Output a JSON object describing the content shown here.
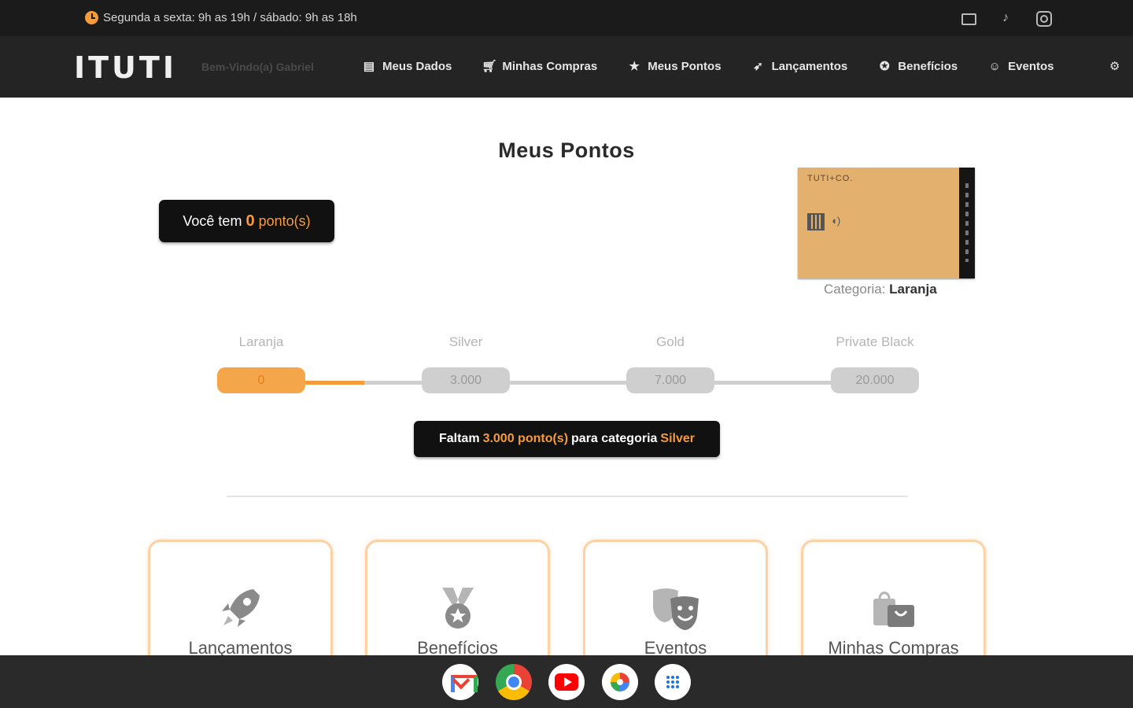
{
  "topbar": {
    "hours": "Segunda a sexta: 9h as 19h / sábado: 9h as 18h",
    "social_icons": [
      "mail-icon",
      "tiktok-icon",
      "instagram-icon"
    ]
  },
  "navbar": {
    "logo": "ITUTI",
    "welcome": "Bem-Vindo(a) Gabriel",
    "items": [
      {
        "label": "Meus Dados",
        "icon": "id-card-icon"
      },
      {
        "label": "Minhas Compras",
        "icon": "cart-icon"
      },
      {
        "label": "Meus Pontos",
        "icon": "star-icon"
      },
      {
        "label": "Lançamentos",
        "icon": "rocket-icon"
      },
      {
        "label": "Benefícios",
        "icon": "medal-icon"
      },
      {
        "label": "Eventos",
        "icon": "masks-icon"
      }
    ]
  },
  "main": {
    "title": "Meus Pontos",
    "points_box": {
      "prefix": "Você tem",
      "points": "0",
      "unit": "ponto(s)"
    },
    "card": {
      "brand": "TUTI+CO.",
      "category_label": "Categoria:",
      "category_value": "Laranja"
    },
    "levels": [
      {
        "name": "Laranja",
        "threshold": "0"
      },
      {
        "name": "Silver",
        "threshold": "3.000"
      },
      {
        "name": "Gold",
        "threshold": "7.000"
      },
      {
        "name": "Private Black",
        "threshold": "20.000"
      }
    ],
    "progress_fraction": 0.17,
    "remaining": {
      "prefix": "Faltam",
      "points": "3.000 ponto(s)",
      "middle": "para categoria",
      "next": "Silver"
    },
    "tiles": [
      {
        "label": "Lançamentos",
        "icon": "rocket-icon"
      },
      {
        "label": "Benefícios",
        "icon": "medal-icon"
      },
      {
        "label": "Eventos",
        "icon": "masks-icon"
      },
      {
        "label": "Minhas Compras",
        "icon": "shopping-bag-icon"
      }
    ]
  },
  "shelf": {
    "apps": [
      "gmail-icon",
      "chrome-icon",
      "youtube-icon",
      "photos-icon",
      "launcher-icon"
    ]
  },
  "colors": {
    "accent": "#f59b3b",
    "dark": "#1b1b1b",
    "tile_border": "#fbd1a5"
  }
}
